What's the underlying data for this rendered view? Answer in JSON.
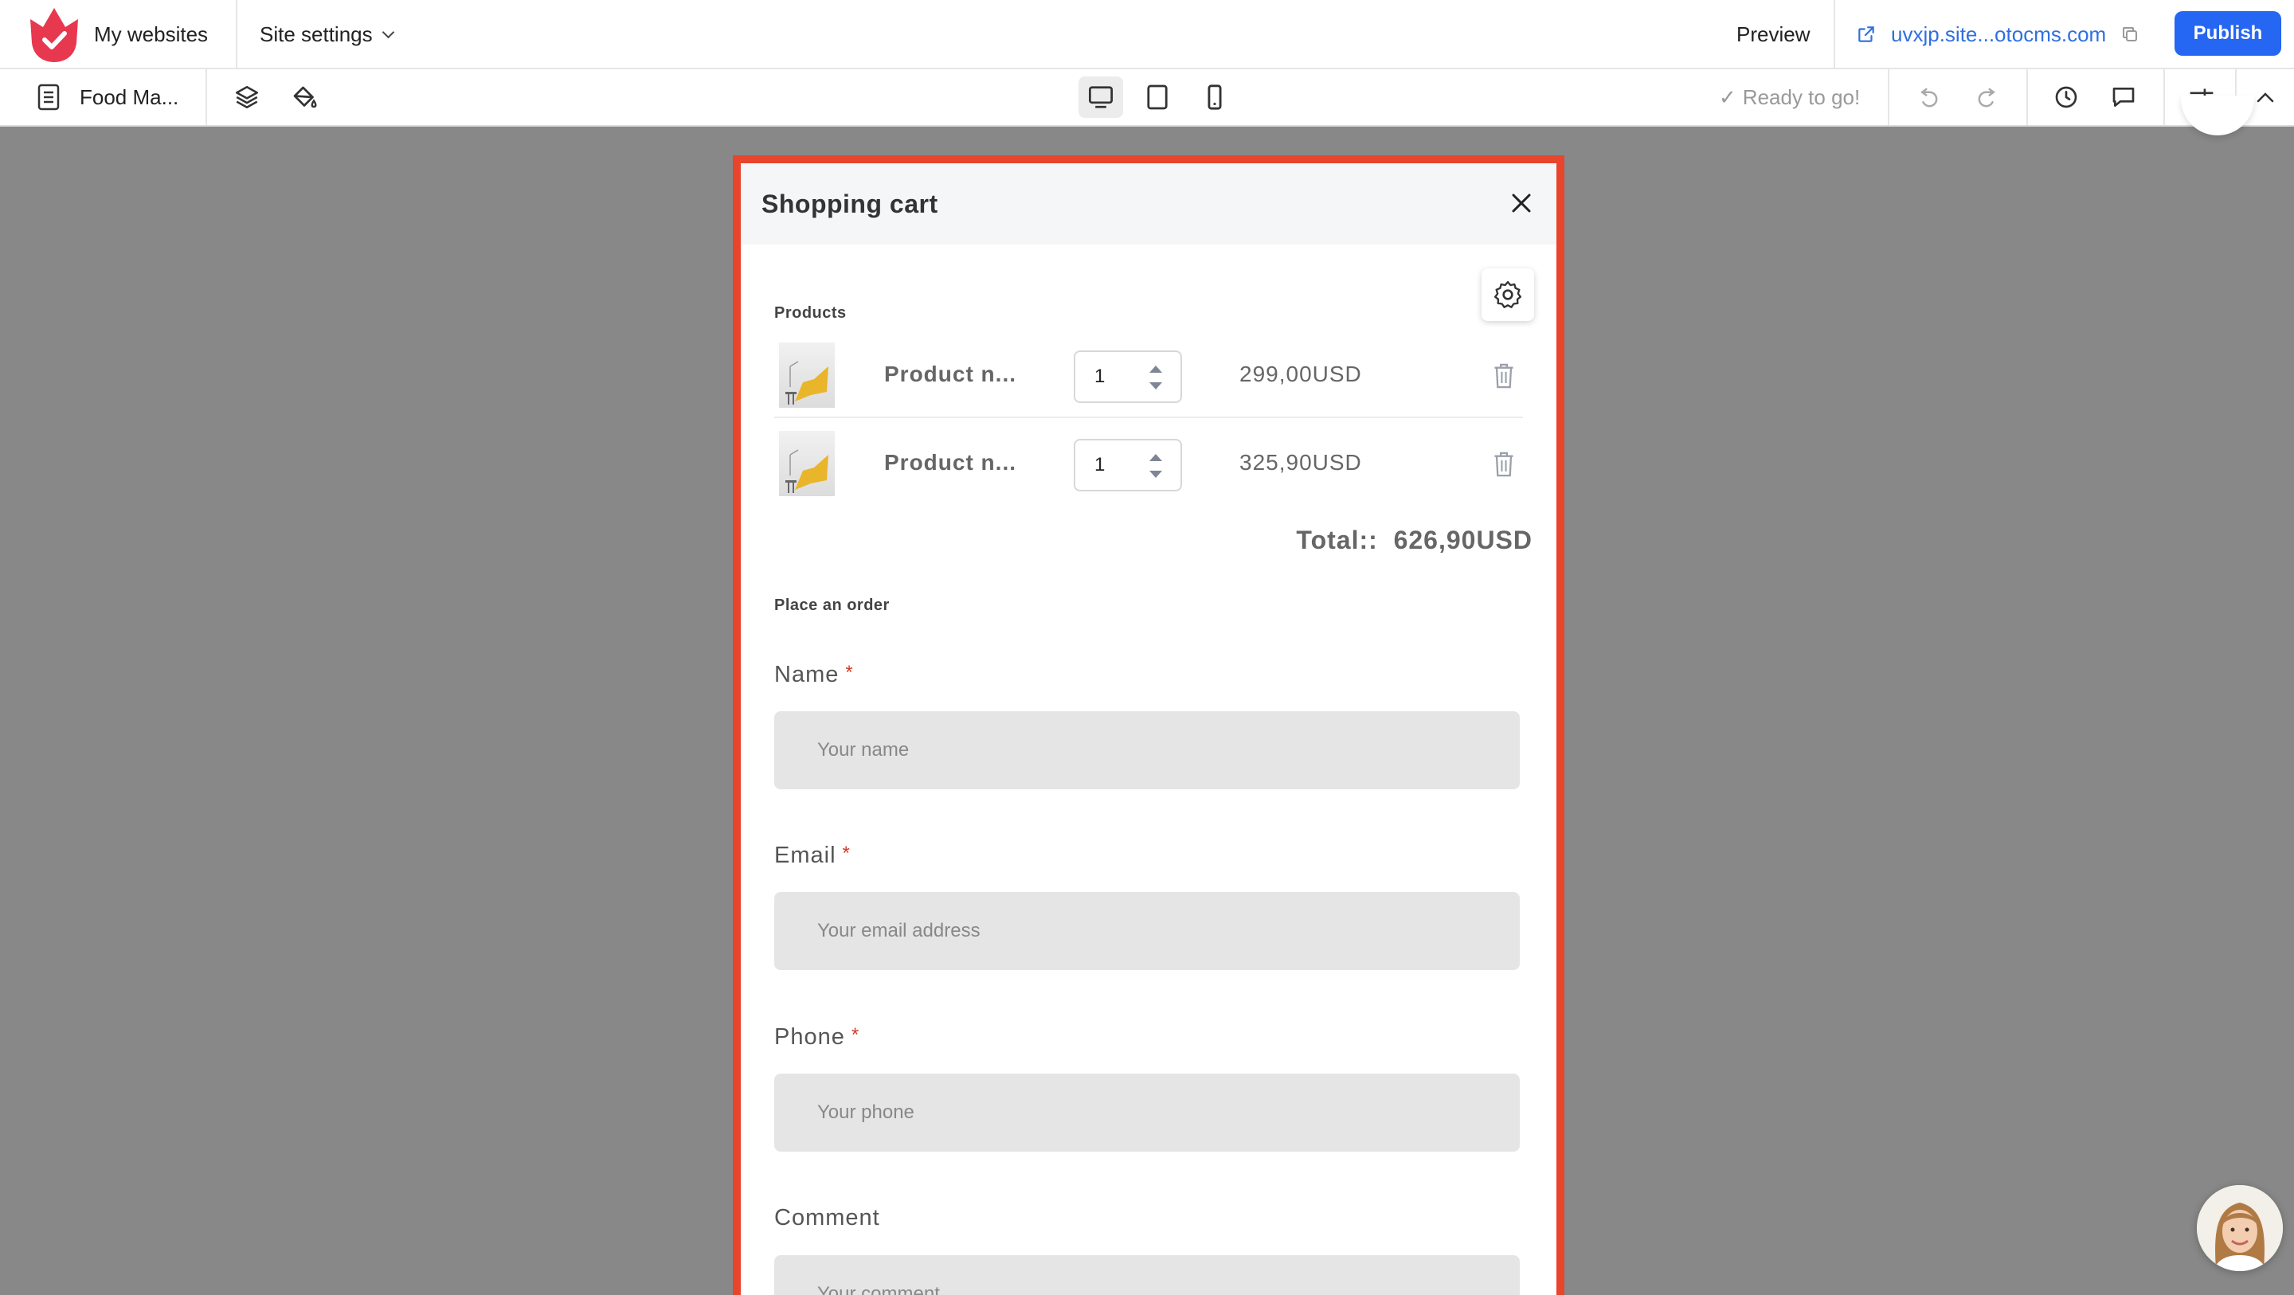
{
  "topbar": {
    "my_websites": "My websites",
    "site_settings": "Site settings",
    "preview": "Preview",
    "site_url": "uvxjp.site...otocms.com",
    "publish": "Publish"
  },
  "toolbar": {
    "page_name": "Food Ma...",
    "status": "Ready to go!",
    "active_device": "desktop"
  },
  "cart": {
    "title": "Shopping cart",
    "products_label": "Products",
    "products": [
      {
        "name": "Product n...",
        "quantity": "1",
        "price": "299,00USD"
      },
      {
        "name": "Product n...",
        "quantity": "1",
        "price": "325,90USD"
      }
    ],
    "total_label": "Total::",
    "total_value": "626,90USD",
    "order_label": "Place an order",
    "fields": [
      {
        "label": "Name",
        "required": "*",
        "placeholder": "Your name"
      },
      {
        "label": "Email",
        "required": "*",
        "placeholder": "Your email address"
      },
      {
        "label": "Phone",
        "required": "*",
        "placeholder": "Your phone"
      },
      {
        "label": "Comment",
        "required": "",
        "placeholder": "Your comment"
      }
    ]
  },
  "colors": {
    "brand_red": "#e8384f",
    "primary_blue": "#2566f2",
    "frame_border": "#e8452c",
    "link_blue": "#2f6fe0"
  },
  "icons": [
    "logo-icon",
    "chevron-down-icon",
    "external-link-icon",
    "copy-icon",
    "page-icon",
    "layers-icon",
    "paint-bucket-icon",
    "desktop-icon",
    "tablet-icon",
    "mobile-icon",
    "check-icon",
    "undo-icon",
    "redo-icon",
    "history-icon",
    "comment-icon",
    "settings-sliders-icon",
    "chevron-up-icon",
    "close-icon",
    "gear-icon",
    "trash-icon"
  ]
}
